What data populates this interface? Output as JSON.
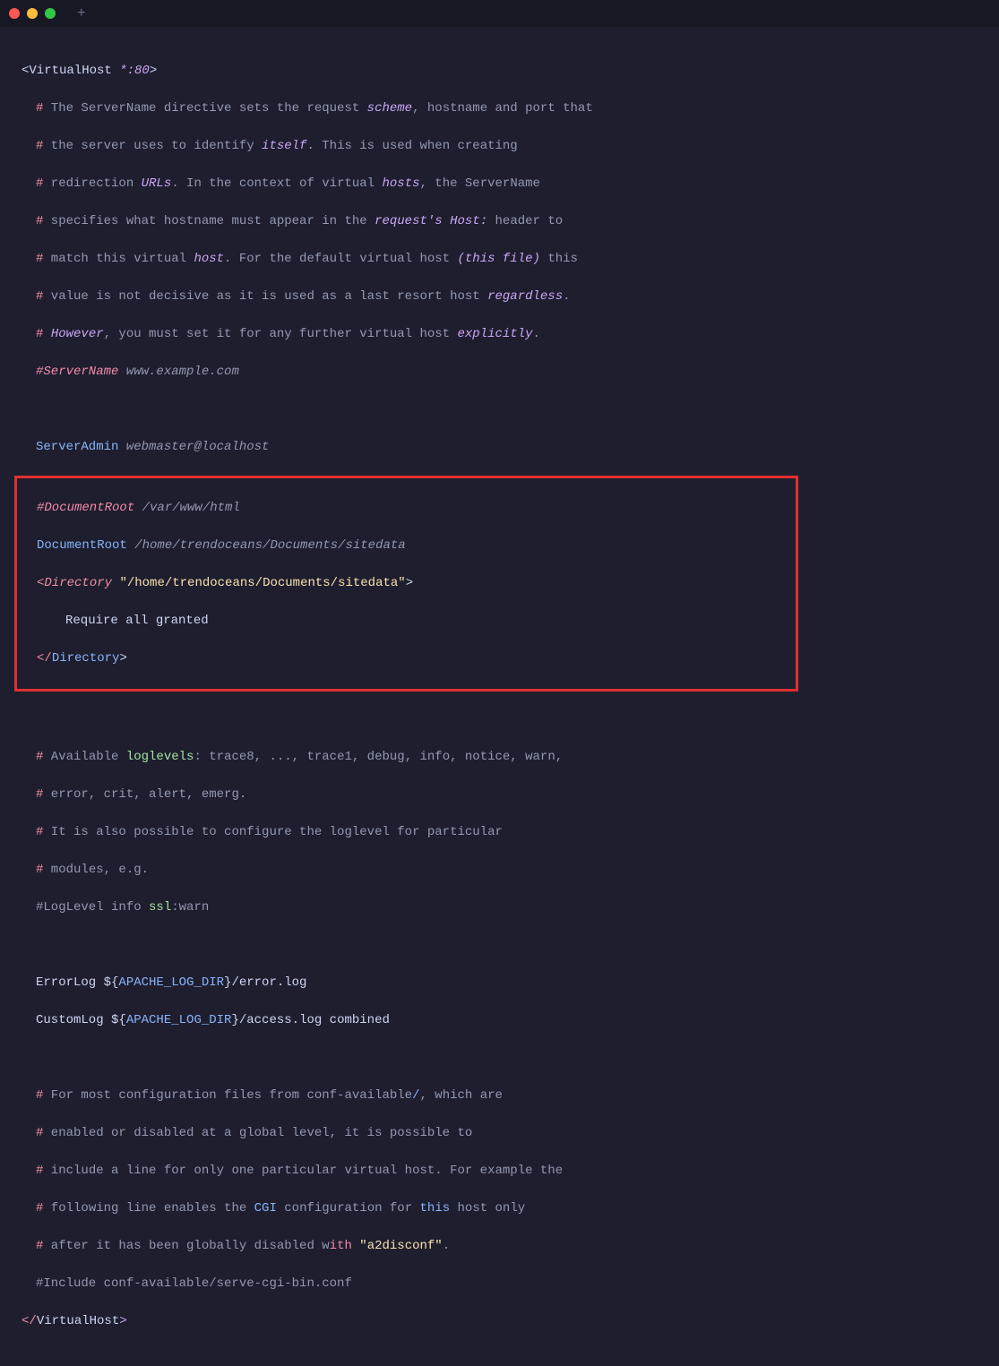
{
  "titlebar": {
    "plus": "+"
  },
  "lines": {
    "l1_open": "<VirtualHost ",
    "l1_port": "*:80",
    "l1_close": ">",
    "l2_h": "#",
    "l2_a": " The ServerName directive sets the request ",
    "l2_b": "scheme",
    "l2_c": ", hostname and port that",
    "l3_h": "#",
    "l3_a": " the server uses to identify ",
    "l3_b": "itself",
    "l3_c": ". This is used when creating",
    "l4_h": "#",
    "l4_a": " redirection ",
    "l4_b": "URLs",
    "l4_c": ". In the context of virtual ",
    "l4_d": "hosts",
    "l4_e": ", the ServerName",
    "l5_h": "#",
    "l5_a": " specifies what hostname must appear in the ",
    "l5_b": "request's Host:",
    "l5_c": " header to",
    "l6_h": "#",
    "l6_a": " match this virtual ",
    "l6_b": "host",
    "l6_c": ". For the default virtual host ",
    "l6_d": "(this file)",
    "l6_e": " this",
    "l7_h": "#",
    "l7_a": " value is not decisive as it is used as a last resort host ",
    "l7_b": "regardless",
    "l7_c": ".",
    "l8_h": "#",
    "l8_a": " ",
    "l8_b": "However",
    "l8_c": ", you must set it for any further virtual host ",
    "l8_d": "explicitly",
    "l8_e": ".",
    "l9_a": "#ServerName ",
    "l9_b": "www.example.com",
    "l10_a": "ServerAdmin ",
    "l10_b": "webmaster@localhost",
    "l11_a": "#DocumentRoot ",
    "l11_b": "/var/www/html",
    "l12_a": "DocumentRoot ",
    "l12_b": "/home/trendoceans/Documents/sitedata",
    "l13_a": "<",
    "l13_b": "Directory",
    "l13_c": " ",
    "l13_d": "\"/home/trendoceans/Documents/sitedata\"",
    "l13_e": ">",
    "l14_a": "Require all granted",
    "l15_a": "</",
    "l15_b": "Directory",
    "l15_c": ">",
    "l16_h": "#",
    "l16_a": " Available ",
    "l16_b": "loglevels",
    "l16_c": ": trace8, ..., trace1, debug, info, notice, warn,",
    "l17_h": "#",
    "l17_a": " error, crit, alert, emerg.",
    "l18_h": "#",
    "l18_a": " It is also possible to configure the loglevel for particular",
    "l19_h": "#",
    "l19_a": " modules, e.g.",
    "l20_a": "#LogLevel info ",
    "l20_b": "ssl",
    "l20_c": ":warn",
    "l21_a": "ErrorLog ${",
    "l21_b": "APACHE_LOG_DIR",
    "l21_c": "}/error.log",
    "l22_a": "CustomLog ${",
    "l22_b": "APACHE_LOG_DIR",
    "l22_c": "}/access.log combined",
    "l23_h": "#",
    "l23_a": " For most configuration files from conf-available",
    "l23_b": "/",
    "l23_c": ", which are",
    "l24_h": "#",
    "l24_a": " enabled or disabled at a global level, it is possible to",
    "l25_h": "#",
    "l25_a": " include a line for only one particular virtual host. For example the",
    "l26_h": "#",
    "l26_a": " following line enables the ",
    "l26_b": "CGI",
    "l26_c": " configuration for ",
    "l26_d": "this",
    "l26_e": " host only",
    "l27_h": "#",
    "l27_a": " after it has been globally disabled ",
    "l27_b": "w",
    "l27_c": "ith",
    "l27_d": " ",
    "l27_e": "\"a2disconf\"",
    "l27_f": ".",
    "l28_a": "#Include conf-available/serve-cgi-bin.conf",
    "l29_a": "</",
    "l29_b": "VirtualHost",
    "l29_c": ">"
  }
}
